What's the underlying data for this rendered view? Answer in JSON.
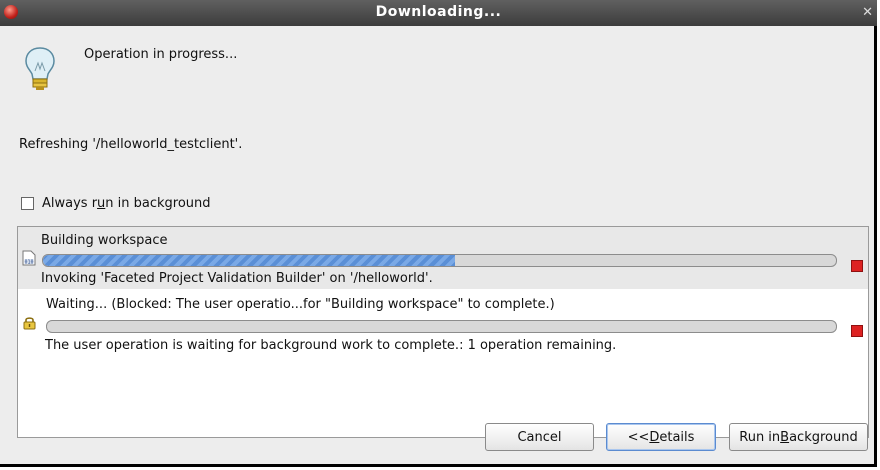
{
  "window": {
    "title": "Downloading..."
  },
  "header": {
    "message": "Operation in progress..."
  },
  "task": {
    "text": "Refreshing '/helloworld_testclient'."
  },
  "background_option": {
    "label_before": "Always r",
    "label_mnemonic": "u",
    "label_after": "n in background",
    "checked": false
  },
  "jobs": [
    {
      "name": "Building workspace",
      "detail": "Invoking 'Faceted Project Validation Builder' on '/helloworld'.",
      "progress": 0.52,
      "icon": "binary-file-icon"
    },
    {
      "name": "Waiting... (Blocked: The user operatio...for \"Building workspace\" to complete.)",
      "detail": "The user operation is waiting for background work to complete.: 1 operation remaining.",
      "progress": 0,
      "icon": "lock-icon"
    }
  ],
  "buttons": {
    "cancel": "Cancel",
    "details_before": "<< ",
    "details_mnemonic": "D",
    "details_after": "etails",
    "run_before": "Run in ",
    "run_mnemonic": "B",
    "run_after": "ackground"
  }
}
